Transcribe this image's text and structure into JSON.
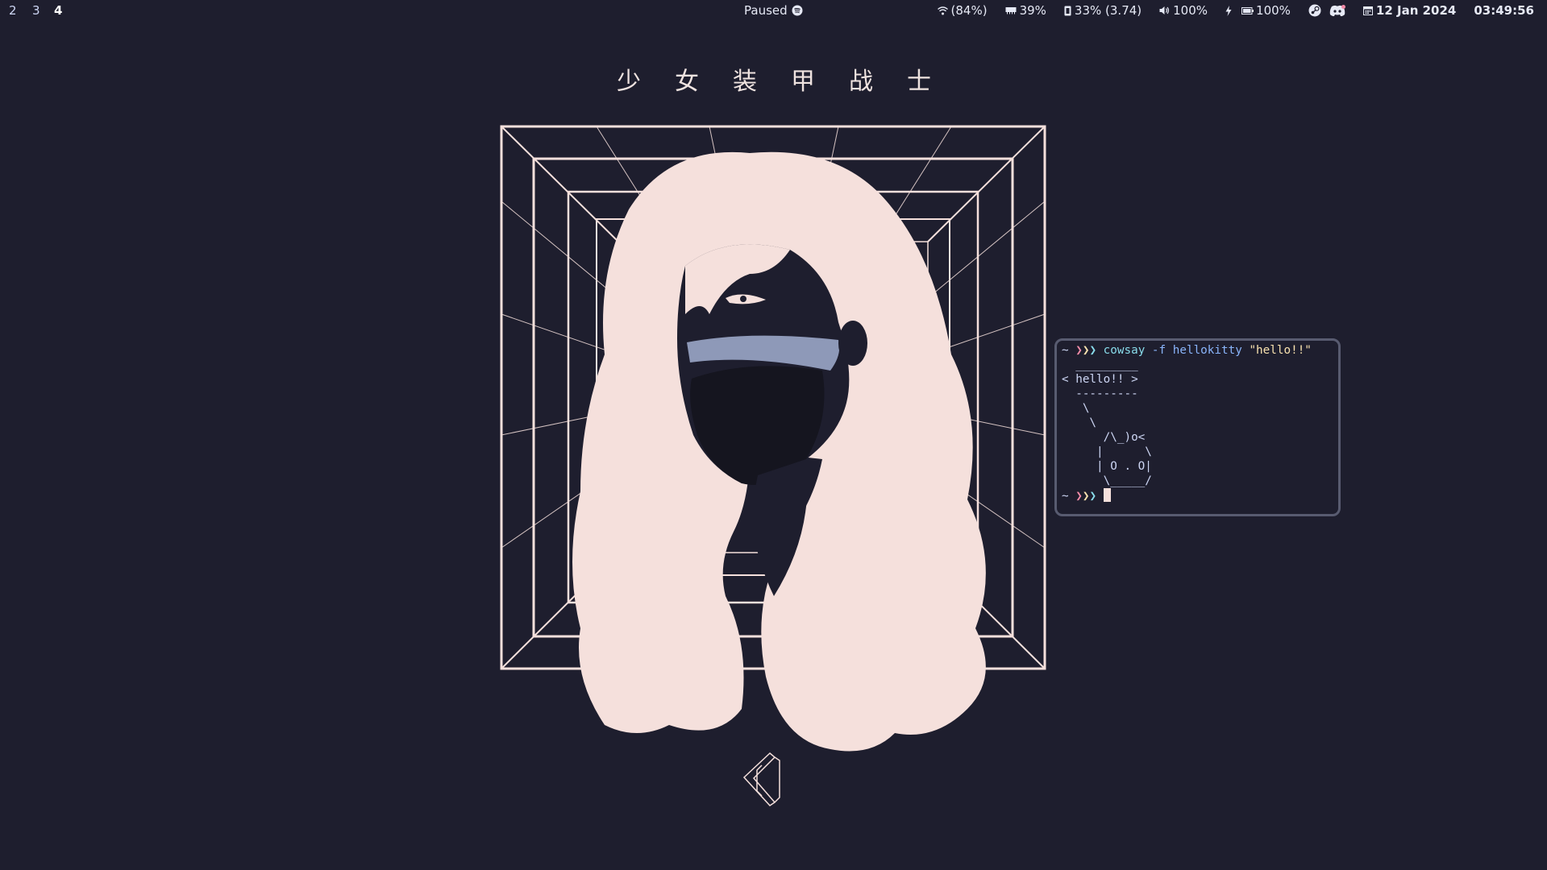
{
  "workspaces": [
    {
      "label": "2",
      "active": false
    },
    {
      "label": "3",
      "active": false
    },
    {
      "label": "4",
      "active": true
    }
  ],
  "media": {
    "status": "Paused",
    "icon": "spotify-icon"
  },
  "status": {
    "wifi": "(84%)",
    "memory": "39%",
    "cpu": "33% (3.74)",
    "volume": "100%",
    "battery": "100%",
    "date": "12 Jan 2024",
    "time": "03:49:56"
  },
  "tray": {
    "icons": [
      "steam-icon",
      "discord-icon"
    ]
  },
  "wallpaper": {
    "title_chars": [
      "少",
      "女",
      "装",
      "甲",
      "战",
      "士"
    ],
    "colors": {
      "background": "#1e1e2e",
      "artwork": "#f5e0dc"
    }
  },
  "terminal": {
    "prompt": "~",
    "prompt_arrows": "❯❯❯",
    "command": {
      "name": "cowsay",
      "args": "-f hellokitty",
      "string": "\"hello!!\""
    },
    "output_lines": [
      "  _________",
      "< hello!! >",
      "  ---------",
      "   \\",
      "    \\",
      "      /\\_)o<",
      "     |      \\",
      "     | O . O|",
      "      \\_____/"
    ]
  }
}
